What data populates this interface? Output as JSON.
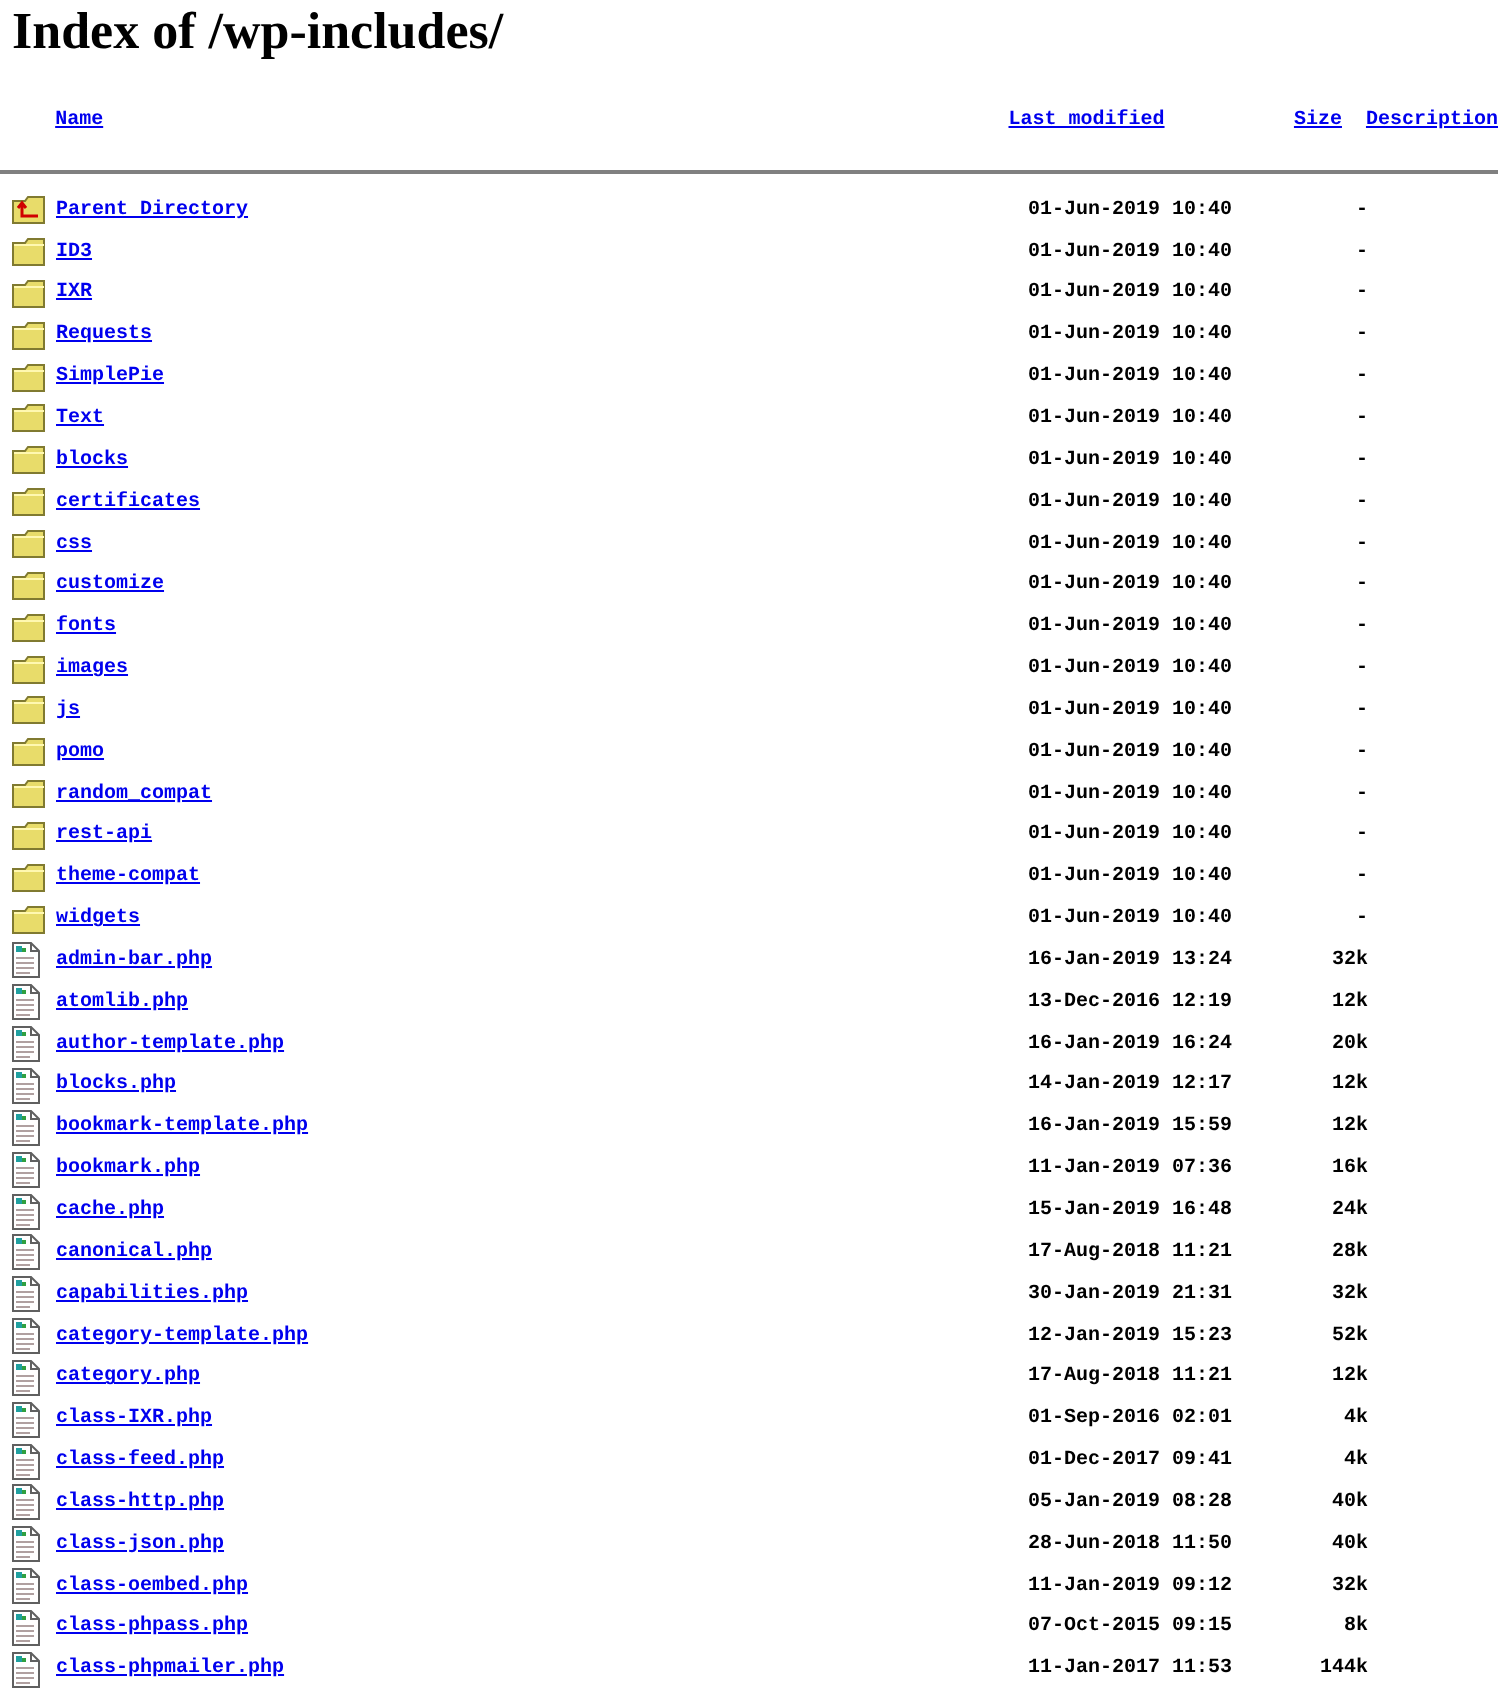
{
  "title": "Index of /wp-includes/",
  "columns": [
    "Name",
    "Last modified",
    "Size",
    "Description"
  ],
  "rows": [
    {
      "kind": "parent",
      "name": "Parent Directory",
      "modified": "01-Jun-2019 10:40",
      "size": "-"
    },
    {
      "kind": "folder",
      "name": "ID3",
      "modified": "01-Jun-2019 10:40",
      "size": "-"
    },
    {
      "kind": "folder",
      "name": "IXR",
      "modified": "01-Jun-2019 10:40",
      "size": "-"
    },
    {
      "kind": "folder",
      "name": "Requests",
      "modified": "01-Jun-2019 10:40",
      "size": "-"
    },
    {
      "kind": "folder",
      "name": "SimplePie",
      "modified": "01-Jun-2019 10:40",
      "size": "-"
    },
    {
      "kind": "folder",
      "name": "Text",
      "modified": "01-Jun-2019 10:40",
      "size": "-"
    },
    {
      "kind": "folder",
      "name": "blocks",
      "modified": "01-Jun-2019 10:40",
      "size": "-"
    },
    {
      "kind": "folder",
      "name": "certificates",
      "modified": "01-Jun-2019 10:40",
      "size": "-"
    },
    {
      "kind": "folder",
      "name": "css",
      "modified": "01-Jun-2019 10:40",
      "size": "-"
    },
    {
      "kind": "folder",
      "name": "customize",
      "modified": "01-Jun-2019 10:40",
      "size": "-"
    },
    {
      "kind": "folder",
      "name": "fonts",
      "modified": "01-Jun-2019 10:40",
      "size": "-"
    },
    {
      "kind": "folder",
      "name": "images",
      "modified": "01-Jun-2019 10:40",
      "size": "-"
    },
    {
      "kind": "folder",
      "name": "js",
      "modified": "01-Jun-2019 10:40",
      "size": "-"
    },
    {
      "kind": "folder",
      "name": "pomo",
      "modified": "01-Jun-2019 10:40",
      "size": "-"
    },
    {
      "kind": "folder",
      "name": "random_compat",
      "modified": "01-Jun-2019 10:40",
      "size": "-"
    },
    {
      "kind": "folder",
      "name": "rest-api",
      "modified": "01-Jun-2019 10:40",
      "size": "-"
    },
    {
      "kind": "folder",
      "name": "theme-compat",
      "modified": "01-Jun-2019 10:40",
      "size": "-"
    },
    {
      "kind": "folder",
      "name": "widgets",
      "modified": "01-Jun-2019 10:40",
      "size": "-"
    },
    {
      "kind": "file",
      "name": "admin-bar.php",
      "modified": "16-Jan-2019 13:24",
      "size": "32k"
    },
    {
      "kind": "file",
      "name": "atomlib.php",
      "modified": "13-Dec-2016 12:19",
      "size": "12k"
    },
    {
      "kind": "file",
      "name": "author-template.php",
      "modified": "16-Jan-2019 16:24",
      "size": "20k"
    },
    {
      "kind": "file",
      "name": "blocks.php",
      "modified": "14-Jan-2019 12:17",
      "size": "12k"
    },
    {
      "kind": "file",
      "name": "bookmark-template.php",
      "modified": "16-Jan-2019 15:59",
      "size": "12k"
    },
    {
      "kind": "file",
      "name": "bookmark.php",
      "modified": "11-Jan-2019 07:36",
      "size": "16k"
    },
    {
      "kind": "file",
      "name": "cache.php",
      "modified": "15-Jan-2019 16:48",
      "size": "24k"
    },
    {
      "kind": "file",
      "name": "canonical.php",
      "modified": "17-Aug-2018 11:21",
      "size": "28k"
    },
    {
      "kind": "file",
      "name": "capabilities.php",
      "modified": "30-Jan-2019 21:31",
      "size": "32k"
    },
    {
      "kind": "file",
      "name": "category-template.php",
      "modified": "12-Jan-2019 15:23",
      "size": "52k"
    },
    {
      "kind": "file",
      "name": "category.php",
      "modified": "17-Aug-2018 11:21",
      "size": "12k"
    },
    {
      "kind": "file",
      "name": "class-IXR.php",
      "modified": "01-Sep-2016 02:01",
      "size": "4k"
    },
    {
      "kind": "file",
      "name": "class-feed.php",
      "modified": "01-Dec-2017 09:41",
      "size": "4k"
    },
    {
      "kind": "file",
      "name": "class-http.php",
      "modified": "05-Jan-2019 08:28",
      "size": "40k"
    },
    {
      "kind": "file",
      "name": "class-json.php",
      "modified": "28-Jun-2018 11:50",
      "size": "40k"
    },
    {
      "kind": "file",
      "name": "class-oembed.php",
      "modified": "11-Jan-2019 09:12",
      "size": "32k"
    },
    {
      "kind": "file",
      "name": "class-phpass.php",
      "modified": "07-Oct-2015 09:15",
      "size": "8k"
    },
    {
      "kind": "file",
      "name": "class-phpmailer.php",
      "modified": "11-Jan-2017 11:53",
      "size": "144k"
    }
  ]
}
